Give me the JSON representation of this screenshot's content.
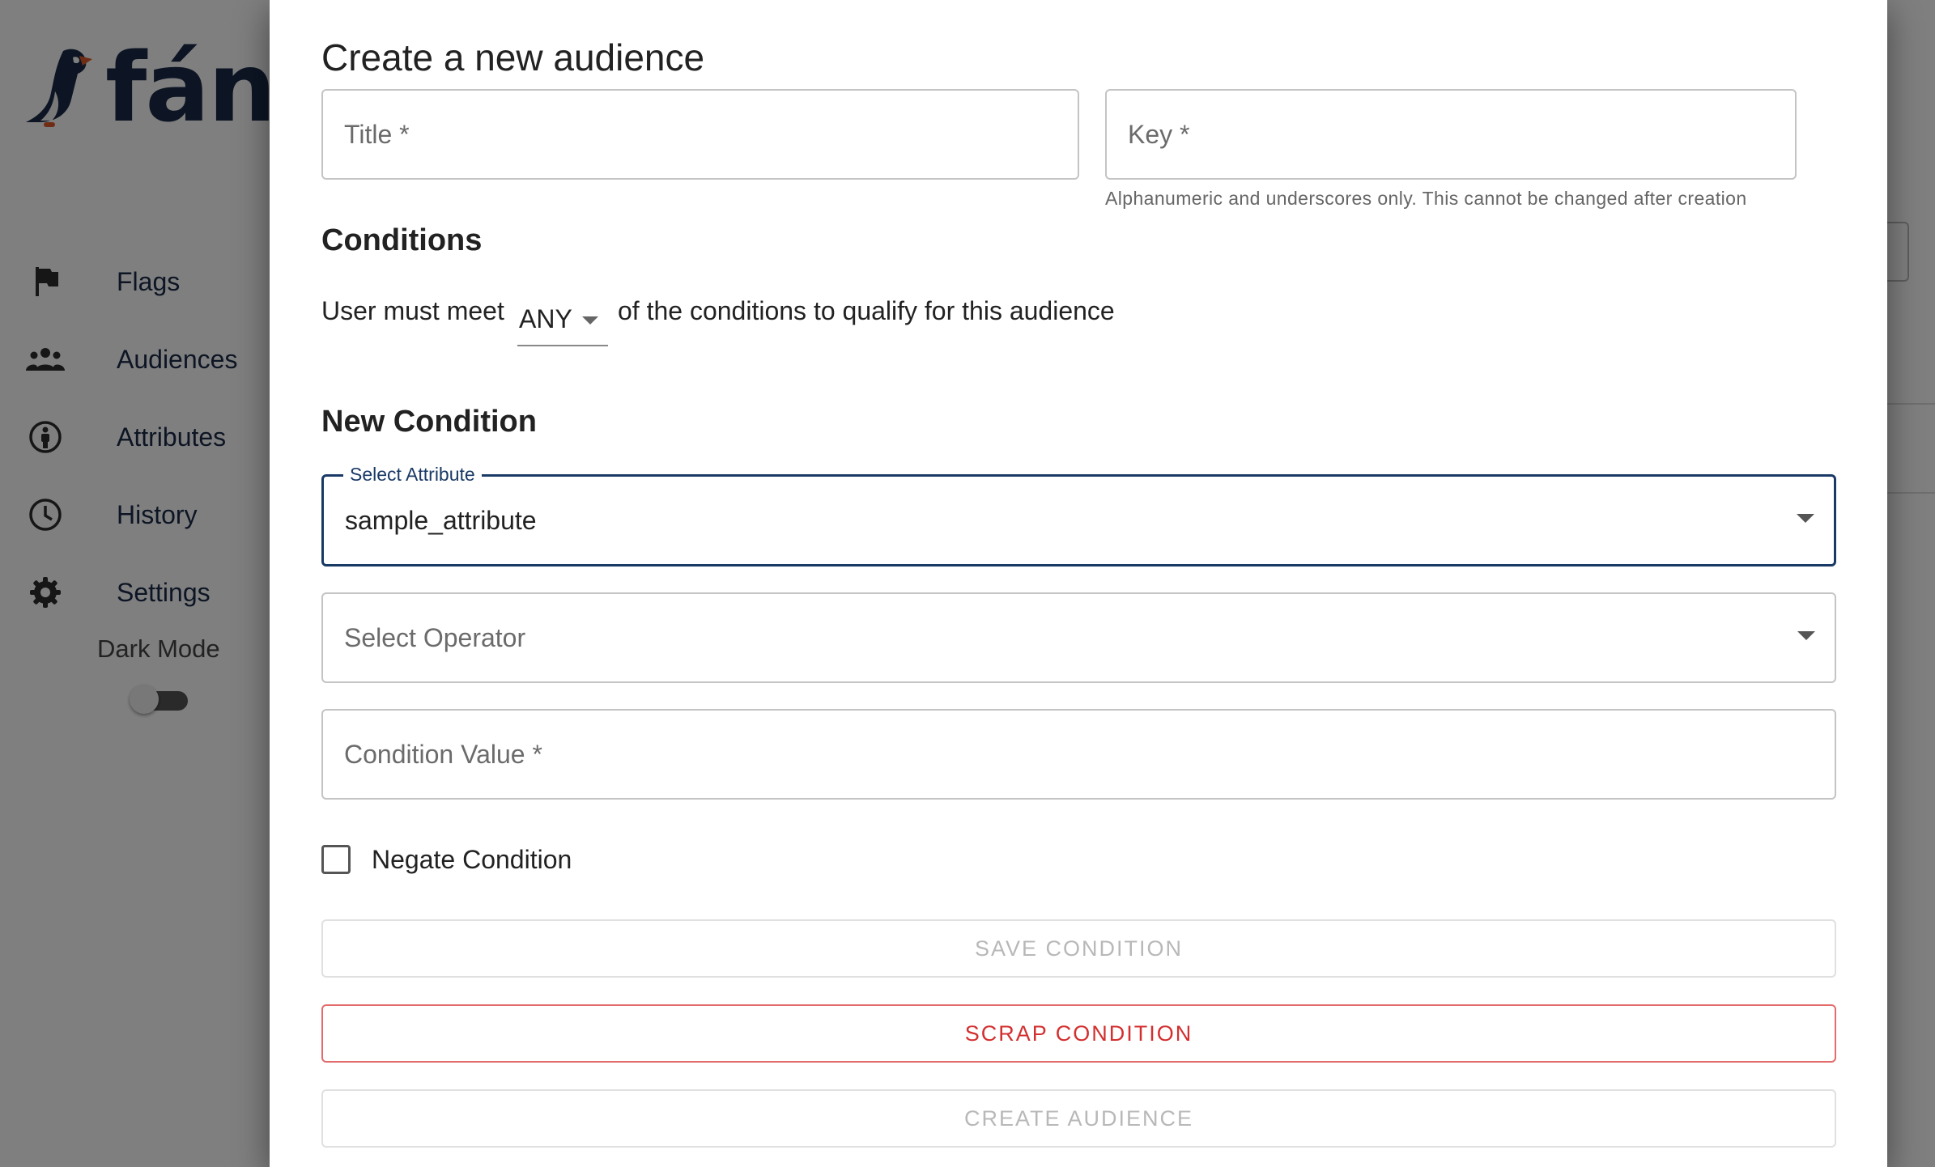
{
  "app": {
    "logo_text": "fánc",
    "nav": [
      {
        "label": "Flags",
        "icon": "flag-icon"
      },
      {
        "label": "Audiences",
        "icon": "people-icon"
      },
      {
        "label": "Attributes",
        "icon": "person-circle-icon"
      },
      {
        "label": "History",
        "icon": "clock-icon"
      },
      {
        "label": "Settings",
        "icon": "gear-icon"
      }
    ],
    "dark_mode_label": "Dark Mode",
    "dark_mode_on": false
  },
  "dialog": {
    "title": "Create a new audience",
    "title_field": {
      "placeholder": "Title *",
      "value": ""
    },
    "key_field": {
      "placeholder": "Key *",
      "value": ""
    },
    "key_helper": "Alphanumeric and underscores only. This cannot be changed after creation",
    "conditions_heading": "Conditions",
    "match_prefix": "User must meet",
    "match_value": "ANY",
    "match_suffix": "of the conditions to qualify for this audience",
    "new_condition_heading": "New Condition",
    "attribute_select": {
      "label": "Select Attribute",
      "value": "sample_attribute"
    },
    "operator_select": {
      "placeholder": "Select Operator",
      "value": ""
    },
    "condition_value": {
      "placeholder": "Condition Value *",
      "value": ""
    },
    "negate_label": "Negate Condition",
    "negate_checked": false,
    "save_button": "SAVE CONDITION",
    "scrap_button": "SCRAP CONDITION",
    "create_button": "CREATE AUDIENCE"
  }
}
